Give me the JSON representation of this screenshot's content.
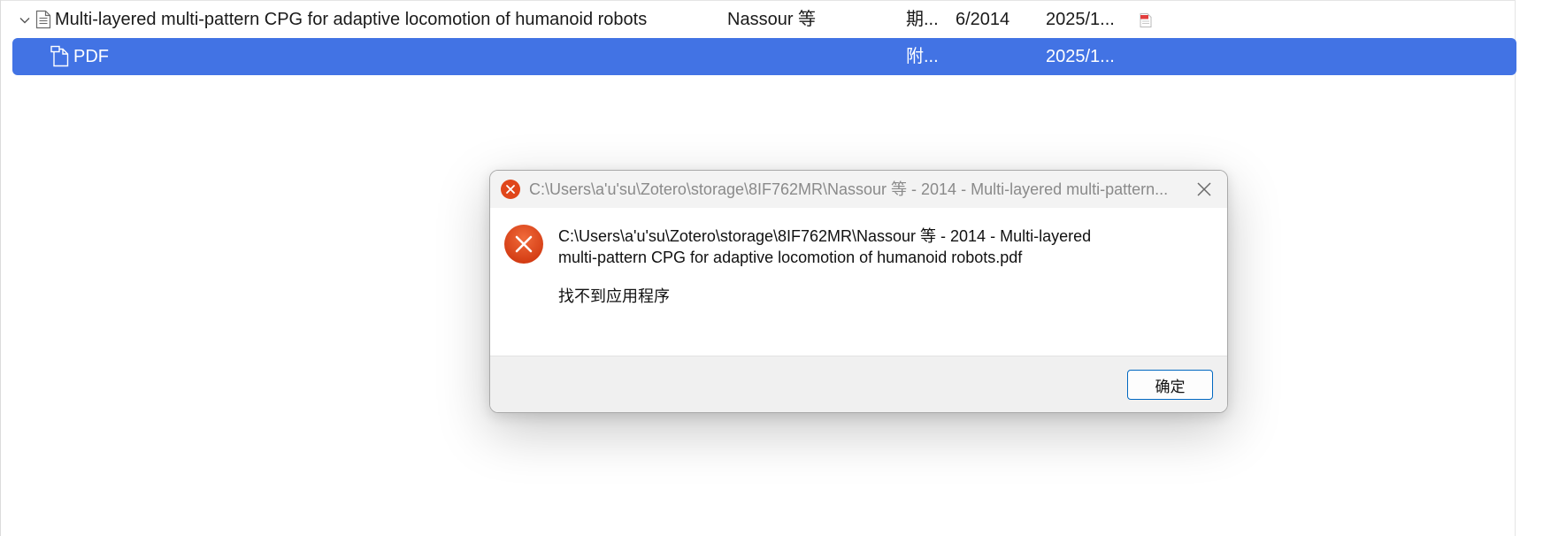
{
  "items": {
    "parent": {
      "title": "Multi-layered multi-pattern CPG for adaptive locomotion of humanoid robots",
      "creator": "Nassour 等",
      "item_type": "期...",
      "date": "6/2014",
      "date_added": "2025/1...",
      "attachment_icon": "pdf-icon"
    },
    "attachment": {
      "title": "PDF",
      "item_type": "附...",
      "date_added": "2025/1..."
    }
  },
  "dialog": {
    "title": "C:\\Users\\a'u'su\\Zotero\\storage\\8IF762MR\\Nassour 等 - 2014 - Multi-layered multi-pattern...",
    "message_line1": "C:\\Users\\a'u'su\\Zotero\\storage\\8IF762MR\\Nassour 等 - 2014 - Multi-layered",
    "message_line2": "multi-pattern CPG for adaptive locomotion of humanoid robots.pdf",
    "detail": "找不到应用程序",
    "ok_label": "确定",
    "icon": "error-icon",
    "close_icon": "close-icon"
  },
  "colors": {
    "selection": "#4273e4",
    "error_red": "#e0461a",
    "button_border": "#0067c0"
  }
}
